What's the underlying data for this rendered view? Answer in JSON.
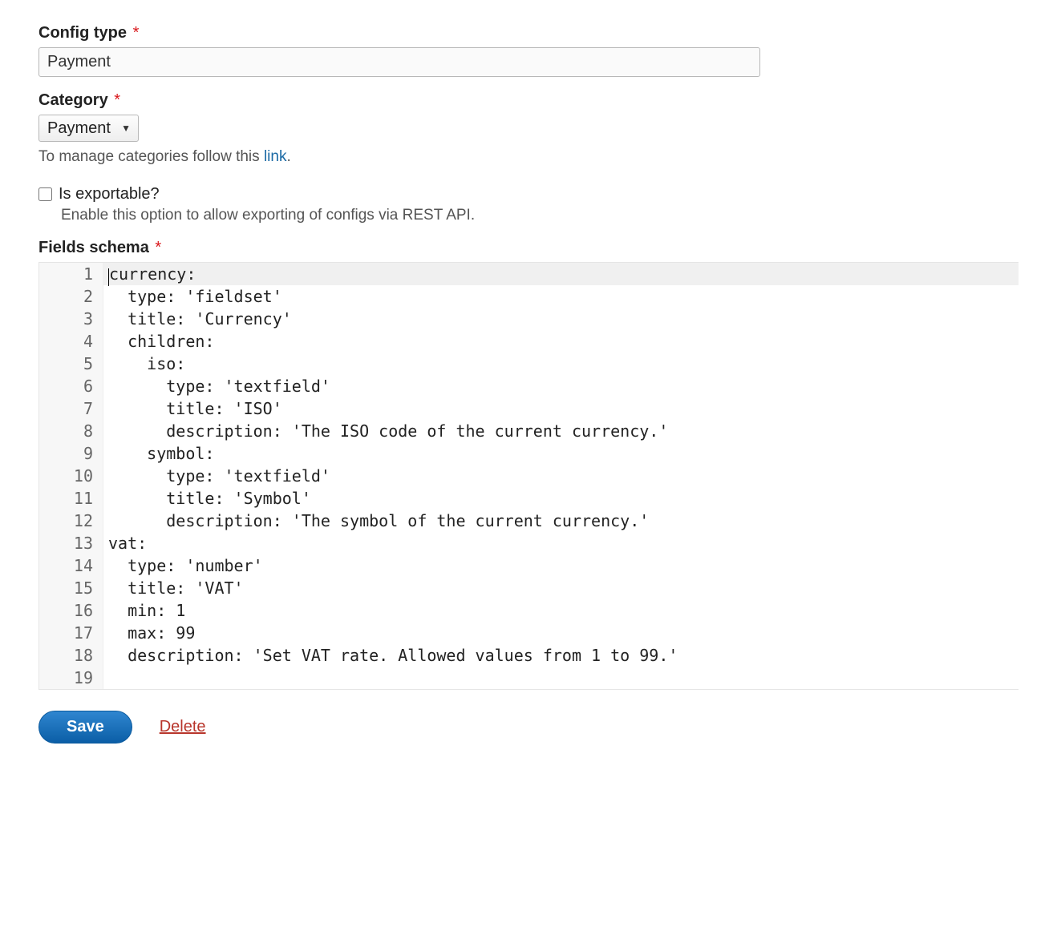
{
  "config_type": {
    "label": "Config type",
    "value": "Payment"
  },
  "category": {
    "label": "Category",
    "selected": "Payment",
    "options": [
      "Payment"
    ],
    "help_prefix": "To manage categories follow this ",
    "help_link_text": "link",
    "help_suffix": "."
  },
  "exportable": {
    "label": "Is exportable?",
    "checked": false,
    "description": "Enable this option to allow exporting of configs via REST API."
  },
  "schema": {
    "label": "Fields schema",
    "active_line": 1,
    "lines": [
      "currency:",
      "  type: 'fieldset'",
      "  title: 'Currency'",
      "  children:",
      "    iso:",
      "      type: 'textfield'",
      "      title: 'ISO'",
      "      description: 'The ISO code of the current currency.'",
      "    symbol:",
      "      type: 'textfield'",
      "      title: 'Symbol'",
      "      description: 'The symbol of the current currency.'",
      "vat:",
      "  type: 'number'",
      "  title: 'VAT'",
      "  min: 1",
      "  max: 99",
      "  description: 'Set VAT rate. Allowed values from 1 to 99.'",
      ""
    ]
  },
  "actions": {
    "save_label": "Save",
    "delete_label": "Delete"
  }
}
